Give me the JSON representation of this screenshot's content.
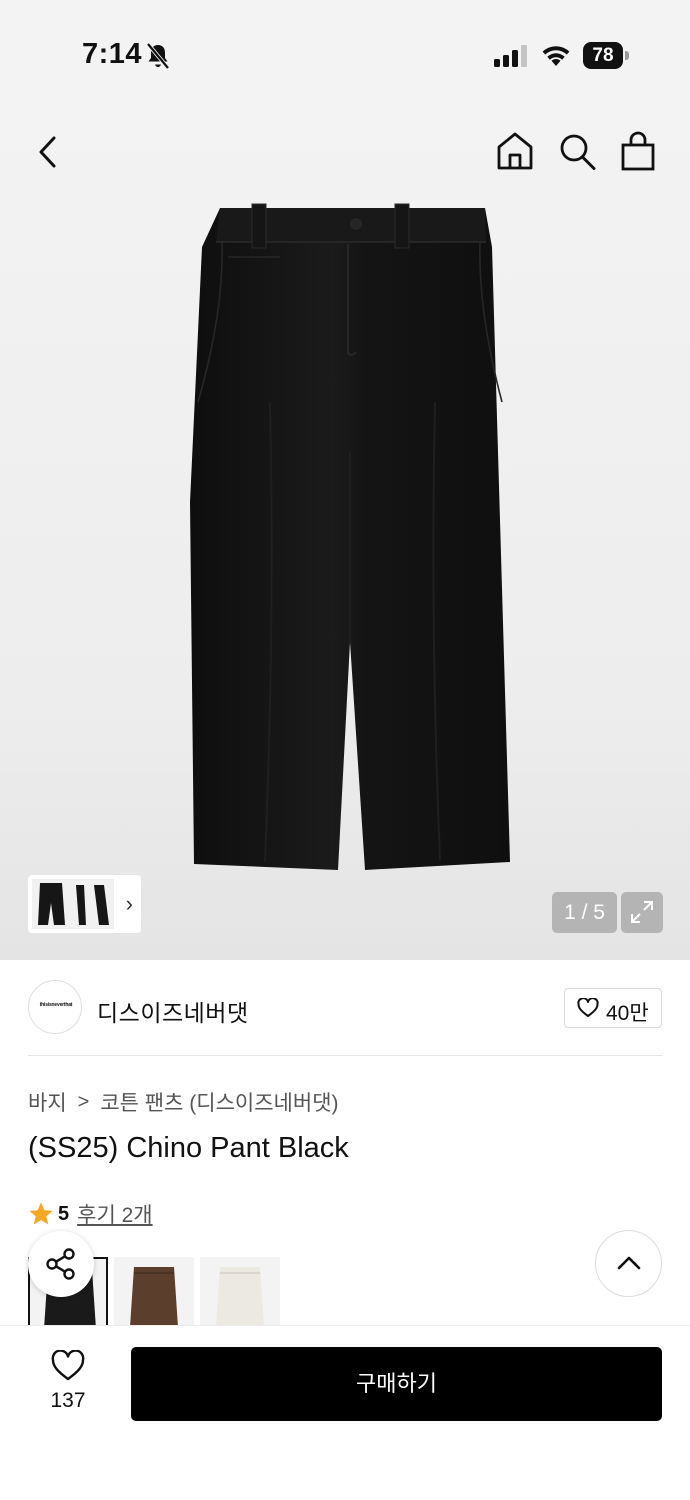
{
  "status_bar": {
    "time": "7:14",
    "battery": "78"
  },
  "header": {
    "icons": [
      "back-icon",
      "home-icon",
      "search-icon",
      "shopping-bag-icon"
    ]
  },
  "gallery": {
    "counter": "1 / 5",
    "thumbnail_chevron": "›"
  },
  "brand": {
    "logo_text": "thisisneverthat",
    "name": "디스이즈네버댓",
    "like_count": "40만"
  },
  "breadcrumb": {
    "category": "바지",
    "separator": ">",
    "subcategory": "코튼 팬츠 (디스이즈네버댓)"
  },
  "product": {
    "title": "(SS25) Chino Pant Black",
    "rating": "5",
    "reviews": "후기 2개"
  },
  "variants": [
    {
      "color": "#1a1a1a"
    },
    {
      "color": "#5b3f2c"
    },
    {
      "color": "#ece9e2"
    }
  ],
  "bottom_bar": {
    "wish_count": "137",
    "buy_label": "구매하기"
  },
  "colors": {
    "accent_star": "#f5a623",
    "buy_button": "#000000"
  }
}
